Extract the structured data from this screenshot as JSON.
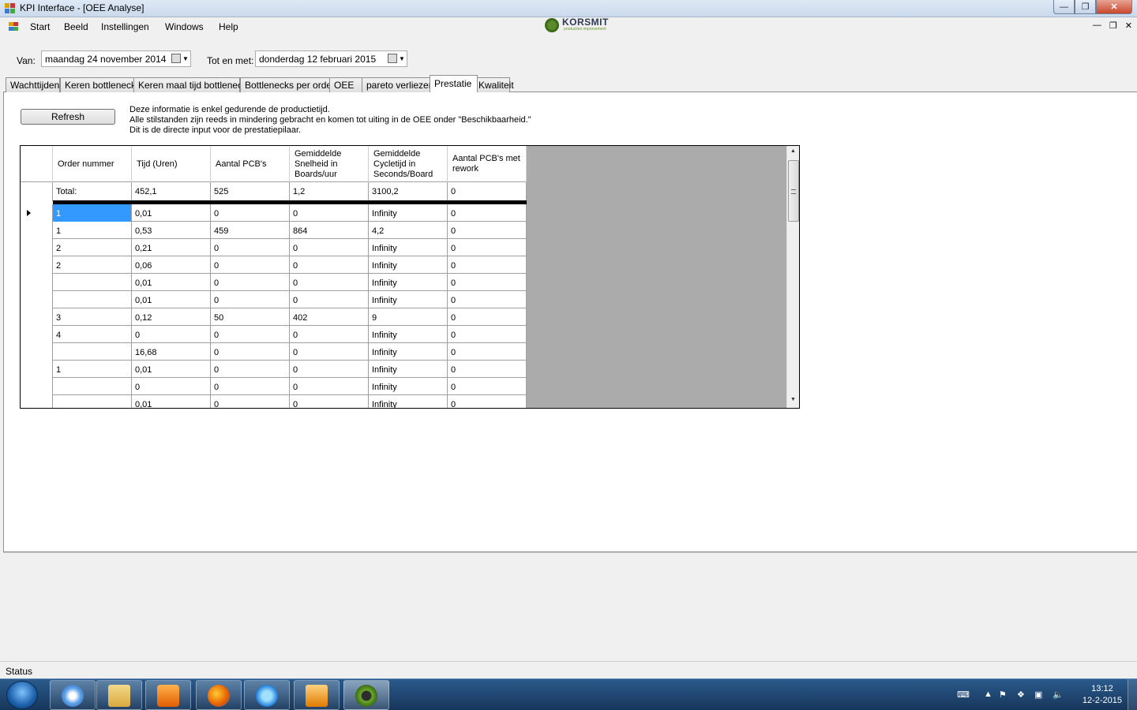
{
  "window": {
    "title": "KPI Interface - [OEE Analyse]"
  },
  "menu": {
    "items": [
      "Start",
      "Beeld",
      "Instellingen",
      "Windows",
      "Help"
    ]
  },
  "logo": {
    "name": "KORSMIT",
    "tagline": "production improvement"
  },
  "dates": {
    "from_label": "Van:",
    "from_value": "maandag  24 november 2014",
    "to_label": "Tot en met:",
    "to_value": "donderdag 12  februari   2015"
  },
  "tabs": [
    "Wachttijden",
    "Keren bottleneck",
    "Keren maal tijd bottleneck",
    "Bottlenecks per order",
    "OEE",
    "pareto verliezen",
    "Prestatie",
    "Kwaliteit"
  ],
  "active_tab": "Prestatie",
  "refresh_label": "Refresh",
  "info_lines": [
    "Deze informatie is enkel gedurende de productietijd.",
    "Alle stilstanden zijn reeds in mindering gebracht en komen tot uiting in de OEE onder \"Beschikbaarheid.\"",
    "Dit is de directe input voor de prestatiepilaar."
  ],
  "grid": {
    "columns": [
      "Order nummer",
      "Tijd (Uren)",
      "Aantal PCB's",
      "Gemiddelde Snelheid in Boards/uur",
      "Gemiddelde Cycletijd in Seconds/Board",
      "Aantal PCB's met rework"
    ],
    "total": [
      "Total:",
      "452,1",
      "525",
      "1,2",
      "3100,2",
      "0"
    ],
    "rows": [
      [
        "1",
        "0,01",
        "0",
        "0",
        "Infinity",
        "0"
      ],
      [
        "1",
        "0,53",
        "459",
        "864",
        "4,2",
        "0"
      ],
      [
        "2",
        "0,21",
        "0",
        "0",
        "Infinity",
        "0"
      ],
      [
        "2",
        "0,06",
        "0",
        "0",
        "Infinity",
        "0"
      ],
      [
        "",
        "0,01",
        "0",
        "0",
        "Infinity",
        "0"
      ],
      [
        "",
        "0,01",
        "0",
        "0",
        "Infinity",
        "0"
      ],
      [
        "3",
        "0,12",
        "50",
        "402",
        "9",
        "0"
      ],
      [
        "4",
        "0",
        "0",
        "0",
        "Infinity",
        "0"
      ],
      [
        "",
        "16,68",
        "0",
        "0",
        "Infinity",
        "0"
      ],
      [
        "1",
        "0,01",
        "0",
        "0",
        "Infinity",
        "0"
      ],
      [
        "",
        "0",
        "0",
        "0",
        "Infinity",
        "0"
      ],
      [
        "",
        "0,01",
        "0",
        "0",
        "Infinity",
        "0"
      ]
    ]
  },
  "status": {
    "text": "Status"
  },
  "taskbar": {
    "apps": [
      "chrome-like-icon",
      "explorer-icon",
      "media-player-icon",
      "firefox-icon",
      "internet-explorer-icon",
      "outlook-icon",
      "kpi-app-icon"
    ],
    "time": "13:12",
    "date": "12-2-2015"
  },
  "colors": {
    "selection": "#3399ff",
    "grid_empty": "#ababab",
    "taskbar": "#1f4a78"
  }
}
